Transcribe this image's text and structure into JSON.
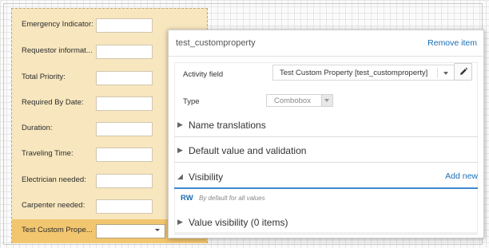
{
  "form": {
    "fields": [
      {
        "label": "Emergency Indicator:"
      },
      {
        "label": "Requestor informat..."
      },
      {
        "label": "Total Priority:"
      },
      {
        "label": "Required By Date:"
      },
      {
        "label": "Duration:"
      },
      {
        "label": "Traveling Time:"
      },
      {
        "label": "Electrician needed:"
      },
      {
        "label": "Carpenter needed:"
      },
      {
        "label": "Test Custom Prope...",
        "selected": true
      }
    ]
  },
  "panel": {
    "title": "test_customproperty",
    "remove_label": "Remove item",
    "activity_field_label": "Activity field",
    "activity_field_value": "Test Custom Property [test_customproperty]",
    "type_label": "Type",
    "type_value": "Combobox",
    "edit_icon": "pencil-icon",
    "sections": {
      "name_translations": "Name translations",
      "default_value": "Default value and validation",
      "visibility": "Visibility",
      "add_new": "Add new",
      "value_visibility": "Value visibility  (0 items)"
    },
    "visibility_entry": {
      "mode": "RW",
      "description": "By default for all values"
    }
  },
  "colors": {
    "accent": "#1b6fb5",
    "form_background": "#f7e6be",
    "selected_row": "#f2c66f"
  }
}
